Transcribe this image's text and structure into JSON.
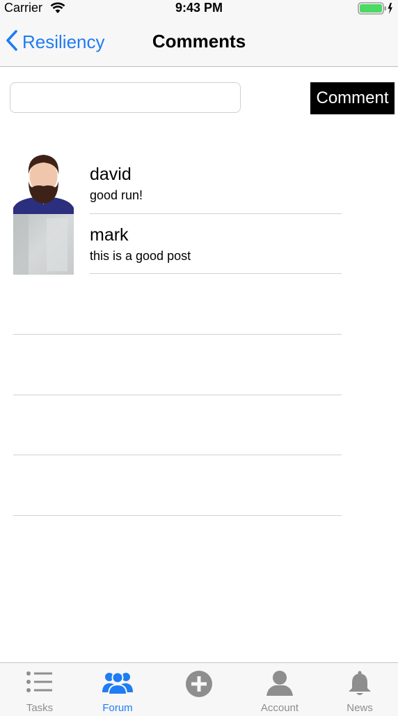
{
  "status_bar": {
    "carrier": "Carrier",
    "time": "9:43 PM"
  },
  "nav": {
    "back_label": "Resiliency",
    "title": "Comments"
  },
  "comment_form": {
    "input_value": "",
    "placeholder": "",
    "button_label": "Comment"
  },
  "comments": [
    {
      "name": "david",
      "text": "good run!"
    },
    {
      "name": "mark",
      "text": "this is a good post"
    }
  ],
  "tabs": [
    {
      "label": "Tasks",
      "icon": "list-icon",
      "active": false
    },
    {
      "label": "Forum",
      "icon": "people-icon",
      "active": true
    },
    {
      "label": "",
      "icon": "plus-circle-icon",
      "active": false
    },
    {
      "label": "Account",
      "icon": "person-icon",
      "active": false
    },
    {
      "label": "News",
      "icon": "bell-icon",
      "active": false
    }
  ],
  "colors": {
    "accent": "#1f7cf3",
    "inactive": "#8e8e8e",
    "bar_background": "#f7f7f7",
    "battery": "#4cd964"
  }
}
